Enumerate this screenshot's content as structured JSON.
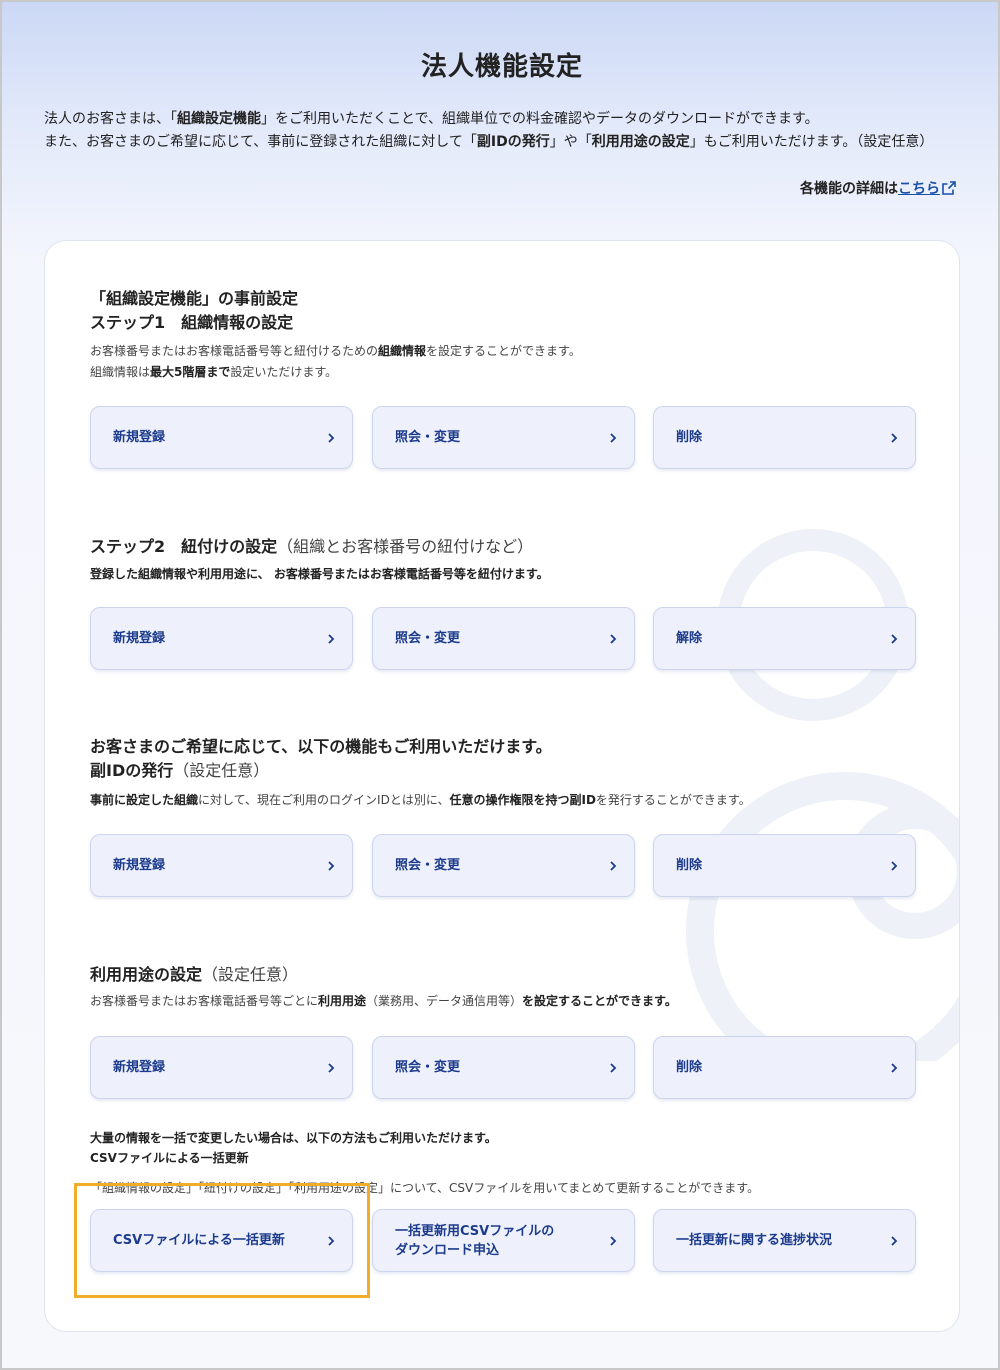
{
  "page": {
    "title": "法人機能設定",
    "intro_line1_a": "法人のお客さまは、「",
    "intro_line1_b": "組織設定機能",
    "intro_line1_c": "」をご利用いただくことで、組織単位での料金確認やデータのダウンロードができます。",
    "intro_line2_a": "また、お客さまのご希望に応じて、事前に登録された組織に対して「",
    "intro_line2_b": "副IDの発行",
    "intro_line2_c": "」や「",
    "intro_line2_d": "利用用途の設定",
    "intro_line2_e": "」もご利用いただけます。（設定任意）",
    "detail_prefix": "各機能の詳細は",
    "detail_link": "こちら"
  },
  "step1": {
    "heading_line1": "「組織設定機能」の事前設定",
    "heading_line2": "ステップ1　組織情報の設定",
    "desc_a": "お客様番号またはお客様電話番号等と紐付けるための",
    "desc_b": "組織情報",
    "desc_c": "を設定することができます。",
    "desc2_a": "組織情報は",
    "desc2_b": "最大5階層まで",
    "desc2_c": "設定いただけます。",
    "buttons": [
      "新規登録",
      "照会・変更",
      "削除"
    ]
  },
  "step2": {
    "heading": "ステップ2　紐付けの設定",
    "heading_sub": "（組織とお客様番号の紐付けなど）",
    "desc": "登録した組織情報や利用用途に、 お客様番号またはお客様電話番号等を紐付けます。",
    "buttons": [
      "新規登録",
      "照会・変更",
      "解除"
    ]
  },
  "subid": {
    "heading_line1": "お客さまのご希望に応じて、以下の機能もご利用いただけます。",
    "heading_line2": "副IDの発行",
    "heading_sub": "（設定任意）",
    "desc_a": "事前に設定した組織",
    "desc_b": "に対して、現在ご利用のログインIDとは別に、",
    "desc_c": "任意の操作権限を持つ副ID",
    "desc_d": "を発行することができます。",
    "buttons": [
      "新規登録",
      "照会・変更",
      "削除"
    ]
  },
  "usage": {
    "heading": "利用用途の設定",
    "heading_sub": "（設定任意）",
    "desc_a": "お客様番号またはお客様電話番号等ごとに",
    "desc_b": "利用用途",
    "desc_c": "（業務用、データ通信用等）",
    "desc_d": "を設定することができます。",
    "buttons": [
      "新規登録",
      "照会・変更",
      "削除"
    ]
  },
  "csv": {
    "intro": "大量の情報を一括で変更したい場合は、以下の方法もご利用いただけます。",
    "heading": "CSVファイルによる一括更新",
    "desc": "「組織情報の設定」「紐付けの設定」「利用用途の設定」について、CSVファイルを用いてまとめて更新することができます。",
    "button1": "CSVファイルによる一括更新",
    "button2_line1": "一括更新用CSVファイルの",
    "button2_line2": "ダウンロード申込",
    "button3": "一括更新に関する進捗状況"
  },
  "icons": {
    "button_arrow": "chevron-right-icon",
    "external_link": "external-link-icon"
  },
  "colors": {
    "accent": "#1c3b8c",
    "link": "#1a4fa8",
    "highlight": "#f1ad2a",
    "button_bg": "#eef1fb"
  }
}
